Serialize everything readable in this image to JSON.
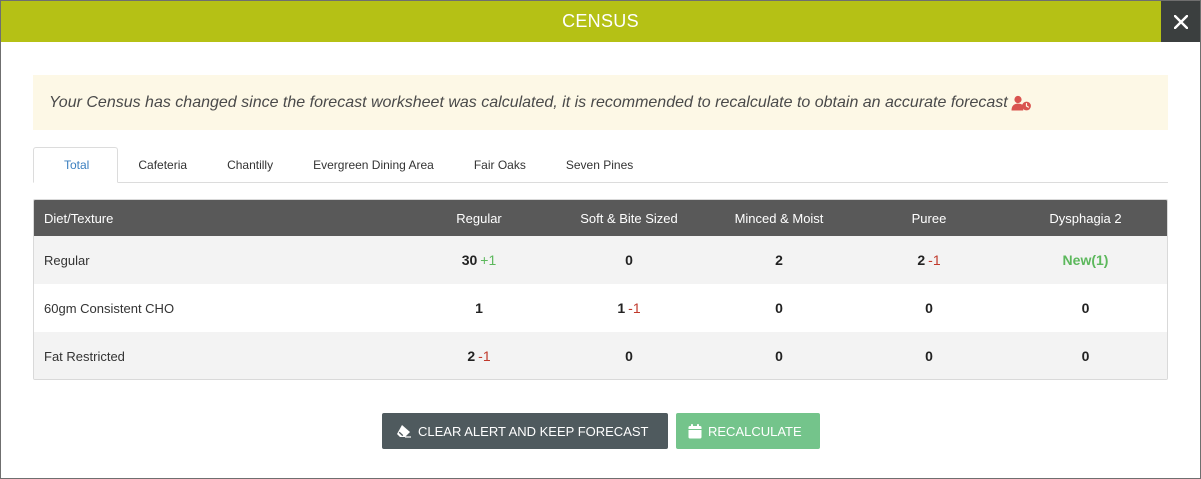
{
  "modal": {
    "title": "CENSUS",
    "close_icon": "close-icon"
  },
  "alert": {
    "message": "Your Census has changed since the forecast worksheet was calculated, it is recommended to recalculate to obtain an accurate forecast",
    "icon": "user-clock-icon",
    "icon_color": "#d9534f"
  },
  "tabs": [
    {
      "label": "Total",
      "active": true
    },
    {
      "label": "Cafeteria"
    },
    {
      "label": "Chantilly"
    },
    {
      "label": "Evergreen Dining Area"
    },
    {
      "label": "Fair Oaks"
    },
    {
      "label": "Seven Pines"
    }
  ],
  "table": {
    "headers": [
      "Diet/Texture",
      "Regular",
      "Soft & Bite Sized",
      "Minced & Moist",
      "Puree",
      "Dysphagia 2"
    ],
    "rows": [
      {
        "label": "Regular",
        "cells": [
          {
            "value": "30",
            "delta": "+1",
            "delta_type": "up"
          },
          {
            "value": "0"
          },
          {
            "value": "2"
          },
          {
            "value": "2",
            "delta": "-1",
            "delta_type": "down"
          },
          {
            "new": "New(1)"
          }
        ]
      },
      {
        "label": "60gm Consistent CHO",
        "cells": [
          {
            "value": "1"
          },
          {
            "value": "1",
            "delta": "-1",
            "delta_type": "down"
          },
          {
            "value": "0"
          },
          {
            "value": "0"
          },
          {
            "value": "0"
          }
        ]
      },
      {
        "label": "Fat Restricted",
        "cells": [
          {
            "value": "2",
            "delta": "-1",
            "delta_type": "down"
          },
          {
            "value": "0"
          },
          {
            "value": "0"
          },
          {
            "value": "0"
          },
          {
            "value": "0"
          }
        ]
      }
    ]
  },
  "buttons": {
    "clear_label": "CLEAR ALERT AND KEEP FORECAST",
    "clear_icon": "eraser-icon",
    "recalc_label": "RECALCULATE",
    "recalc_icon": "calendar-icon"
  },
  "colors": {
    "header_bg": "#b5c115",
    "table_header_bg": "#595959",
    "positive": "#5cb85c",
    "negative": "#c0392b",
    "recalc_bg": "#74c48b",
    "clear_bg": "#4f5a5e"
  }
}
